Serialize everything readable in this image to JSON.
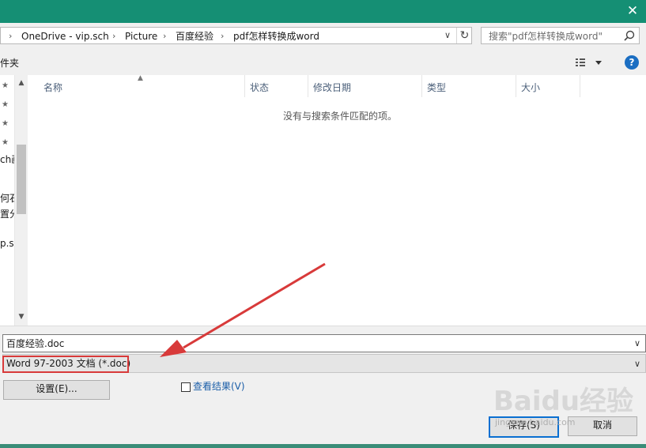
{
  "window": {
    "close_glyph": "✕",
    "titlebar_color": "#158f74"
  },
  "address": {
    "crumbs": [
      "OneDrive - vip.sch",
      "Picture",
      "百度经验",
      "pdf怎样转换成word"
    ],
    "separator": "›"
  },
  "search": {
    "placeholder": "搜索\"pdf怎样转换成word\""
  },
  "toolbar": {
    "label": "件夹",
    "help": "?"
  },
  "nav": {
    "fragments": [
      "ch画",
      "何石",
      "置分",
      "p.sc"
    ]
  },
  "columns": [
    "名称",
    "状态",
    "修改日期",
    "类型",
    "大小"
  ],
  "list": {
    "empty_message": "没有与搜索条件匹配的项。"
  },
  "form": {
    "filename": "百度经验.doc",
    "filetype": "Word 97-2003 文档 (*.doc)",
    "settings_button": "设置(E)...",
    "view_results_label": "查看结果(V)",
    "save_button": "保存(S)",
    "cancel_button": "取消"
  },
  "annotation": {
    "color": "#d83a3a"
  },
  "watermark": {
    "brand": "Baidu经验",
    "url": "jingyan.baidu.com"
  }
}
